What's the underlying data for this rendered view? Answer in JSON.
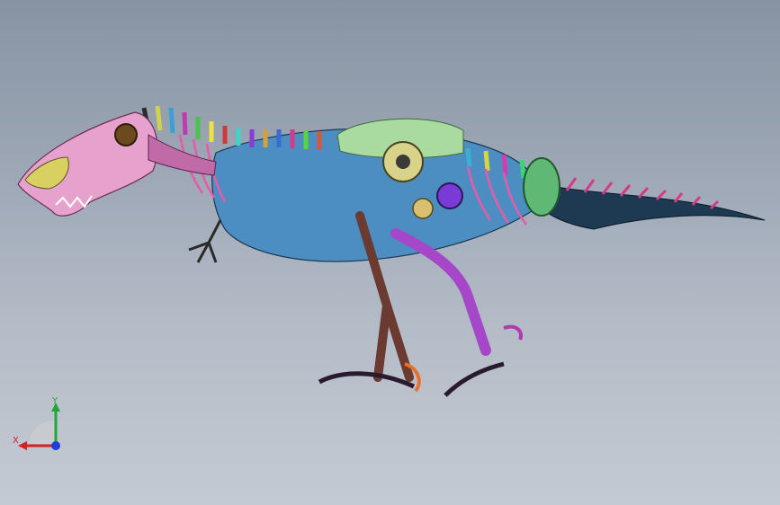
{
  "colors": {
    "background_top": "#8793a3",
    "background_bottom": "#c4cad3",
    "axis_x": "#d81e1e",
    "axis_y": "#1fa83a",
    "axis_z": "#1e3fd8"
  },
  "model": {
    "subject": "mechanical-trex-assembly"
  },
  "triad": {
    "x_label": "X",
    "y_label": "Y"
  }
}
